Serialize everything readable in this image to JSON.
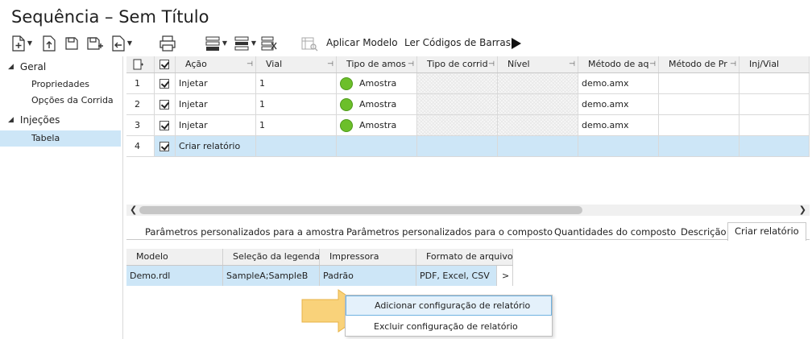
{
  "window": {
    "title": "Sequência – Sem Título"
  },
  "toolbar": {
    "icons": [
      "new-icon",
      "import-icon",
      "save-icon",
      "save-as-icon",
      "export-icon",
      "print-icon",
      "insert-row-icon",
      "delete-row-icon",
      "fill-down-icon",
      "template-icon"
    ],
    "apply_template_label": "Aplicar Modelo",
    "read_barcodes_label": "Ler Códigos de Barras",
    "run_icon": "play-icon"
  },
  "nav": {
    "groups": [
      {
        "label": "Geral",
        "items": [
          {
            "label": "Propriedades"
          },
          {
            "label": "Opções da Corrida"
          }
        ]
      },
      {
        "label": "Injeções",
        "items": [
          {
            "label": "Tabela",
            "selected": true
          }
        ]
      }
    ]
  },
  "grid": {
    "columns": [
      "Ação",
      "Vial",
      "Tipo de amos",
      "Tipo de corrid",
      "Nível",
      "Método de aq",
      "Método de Pr",
      "Inj/Vial"
    ],
    "rows": [
      {
        "num": "1",
        "action": "Injetar",
        "vial": "1",
        "sample_type": "Amostra",
        "method": "demo.amx"
      },
      {
        "num": "2",
        "action": "Injetar",
        "vial": "1",
        "sample_type": "Amostra",
        "method": "demo.amx"
      },
      {
        "num": "3",
        "action": "Injetar",
        "vial": "1",
        "sample_type": "Amostra",
        "method": "demo.amx"
      },
      {
        "num": "4",
        "action": "Criar relatório",
        "vial": "",
        "sample_type": "",
        "method": ""
      }
    ],
    "status_color": "#6cbf2a",
    "selected_row_color": "#cde6f7"
  },
  "tabs": [
    {
      "label": "Parâmetros personalizados para a amostra"
    },
    {
      "label": "Parâmetros personalizados para o composto"
    },
    {
      "label": "Quantidades do composto"
    },
    {
      "label": "Descrição"
    },
    {
      "label": "Criar relatório",
      "active": true
    }
  ],
  "report_table": {
    "columns": [
      "Modelo",
      "Seleção da legenda",
      "Impressora",
      "Formato de arquivo"
    ],
    "row": {
      "model": "Demo.rdl",
      "legend": "SampleA;SampleB",
      "printer": "Padrão",
      "format": "PDF, Excel, CSV",
      "more": ">"
    }
  },
  "context_menu": {
    "items": [
      {
        "label": "Adicionar configuração de relatório",
        "hover": true
      },
      {
        "label": "Excluir configuração de relatório"
      }
    ]
  },
  "callout_color": "#f9c74f"
}
